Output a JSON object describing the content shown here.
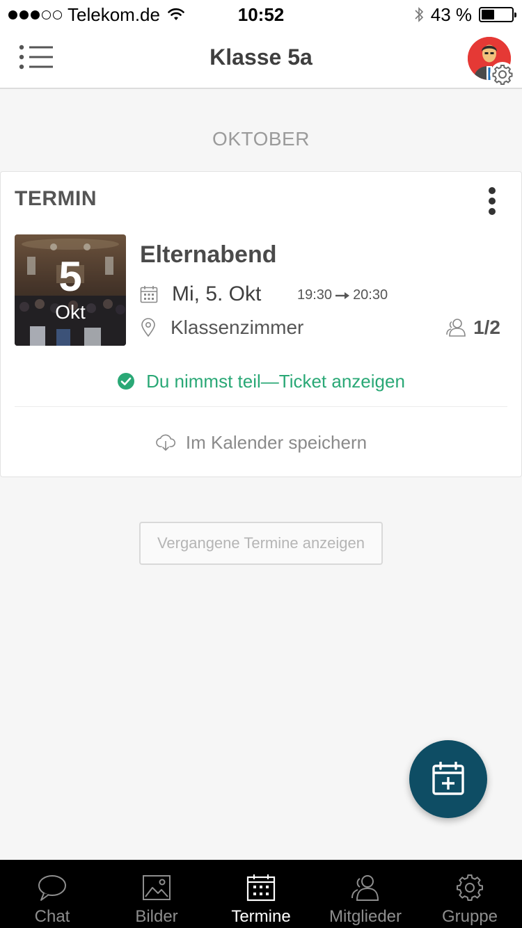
{
  "status_bar": {
    "carrier": "Telekom.de",
    "time": "10:52",
    "battery": "43 %",
    "battery_level": 0.43
  },
  "nav": {
    "title": "Klasse 5a",
    "menu_icon": "list-menu-icon",
    "avatar_icon": "user-avatar",
    "settings_icon": "gear-icon"
  },
  "month": "OKTOBER",
  "event_card": {
    "label": "TERMIN",
    "thumb_day": "5",
    "thumb_month": "Okt",
    "title": "Elternabend",
    "date": "Mi, 5. Okt",
    "time_start": "19:30",
    "time_end": "20:30",
    "location": "Klassenzimmer",
    "participants": "1/2",
    "attend_text": "Du nimmst teil—Ticket anzeigen",
    "save_calendar": "Im Kalender speichern",
    "colors": {
      "attend": "#2aa876"
    }
  },
  "past_events_button": "Vergangene Termine anzeigen",
  "fab": {
    "icon": "calendar-add-icon",
    "color": "#0e4d64"
  },
  "tabs": [
    {
      "label": "Chat",
      "icon": "chat-icon",
      "active": false
    },
    {
      "label": "Bilder",
      "icon": "image-icon",
      "active": false
    },
    {
      "label": "Termine",
      "icon": "calendar-icon",
      "active": true
    },
    {
      "label": "Mitglieder",
      "icon": "members-icon",
      "active": false
    },
    {
      "label": "Gruppe",
      "icon": "gear-icon",
      "active": false
    }
  ]
}
